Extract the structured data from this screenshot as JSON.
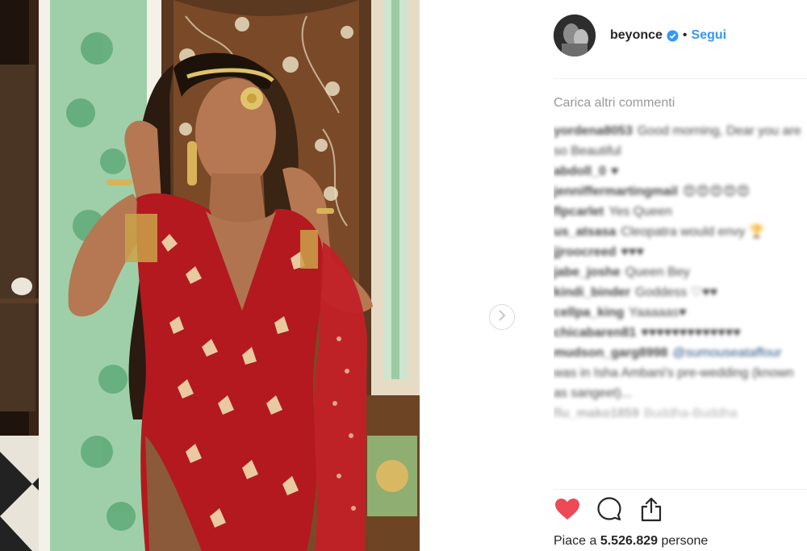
{
  "post": {
    "image_alt": "Beyoncé wearing red embellished gown with gold head jewelry",
    "next_icon": "chevron-right-icon"
  },
  "author": {
    "username": "beyonce",
    "verified": true,
    "separator": "•",
    "follow_label": "Segui"
  },
  "comments": {
    "load_more_label": "Carica altri commenti",
    "items": [
      {
        "user": "yordena8053",
        "text": "Good morning, Dear you are so Beautiful"
      },
      {
        "user": "abdoll_0",
        "text": "♥"
      },
      {
        "user": "jenniffermartingmail",
        "text": "😍😍😍😍😍"
      },
      {
        "user": "flpcarlet",
        "text": "Yes Queen"
      },
      {
        "user": "us_atsasa",
        "text": "Cleopatra would envy 🏆"
      },
      {
        "user": "jjroocreed",
        "text": "♥♥♥"
      },
      {
        "user": "jabe_joshe",
        "text": "Queen Bey"
      },
      {
        "user": "kindi_binder",
        "text": "Goddess ♡♥♥"
      },
      {
        "user": "cellpa_king",
        "text": "Yaaaaas♥"
      },
      {
        "user": "chicabaren81",
        "text": "♥♥♥♥♥♥♥♥♥♥♥♥♥"
      },
      {
        "user": "mudson_garg8998",
        "text": "was in Isha Ambani's pre-wedding (known as sangeet)...",
        "mention": "@sumouseataffour"
      },
      {
        "user": "flu_mako1859",
        "text": "Buddha-Buddha"
      }
    ]
  },
  "actions": {
    "like_icon": "heart-filled-icon",
    "comment_icon": "comment-icon",
    "share_icon": "share-icon"
  },
  "likes": {
    "prefix": "Piace a",
    "count": "5.526.829",
    "suffix": "persone"
  },
  "colors": {
    "link_blue": "#3897f0",
    "like_red": "#ed4956",
    "muted_gray": "#999999",
    "text": "#262626"
  }
}
